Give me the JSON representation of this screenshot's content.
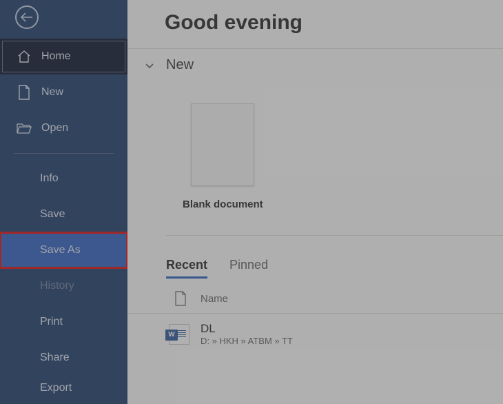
{
  "greeting": "Good evening",
  "sidebar": {
    "back_label": "Back",
    "home": "Home",
    "new": "New",
    "open": "Open",
    "info": "Info",
    "save": "Save",
    "save_as": "Save As",
    "history": "History",
    "print": "Print",
    "share": "Share",
    "export": "Export"
  },
  "new_section": {
    "title": "New",
    "templates": [
      {
        "label": "Blank document"
      }
    ]
  },
  "tabs": {
    "recent": "Recent",
    "pinned": "Pinned"
  },
  "list": {
    "name_header": "Name",
    "items": [
      {
        "name": "DL",
        "path": "D: » HKH » ATBM » TT"
      }
    ]
  },
  "colors": {
    "sidebar_bg": "#1b3a6a",
    "sidebar_active": "#07112a",
    "highlight_bg": "#2f5ec4",
    "highlight_border": "#e4080a",
    "accent": "#2160c4"
  }
}
